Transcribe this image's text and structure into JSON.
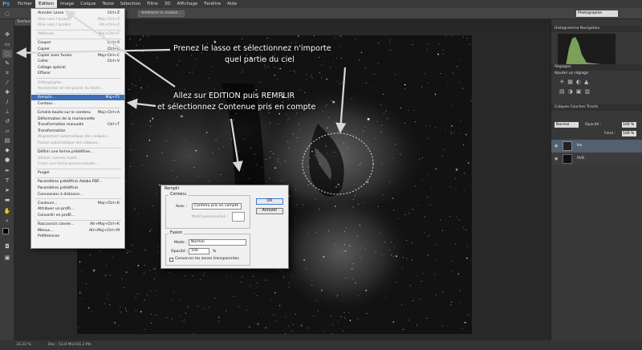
{
  "menubar": {
    "logo": "Ps",
    "items": [
      "Fichier",
      "Edition",
      "Image",
      "Calque",
      "Texte",
      "Sélection",
      "Filtre",
      "3D",
      "Affichage",
      "Fenêtre",
      "Aide"
    ]
  },
  "options": {
    "refine_button": "Améliorer le contour...",
    "workspace": "Photographie"
  },
  "document": {
    "tab": "Test%dat..."
  },
  "edit_menu": {
    "items": [
      {
        "label": "Annuler Lasso",
        "shortcut": "Ctrl+Z"
      },
      {
        "label": "Aller vers l'avant",
        "shortcut": "Maj+Ctrl+Z"
      },
      {
        "label": "Aller vers l'arrière",
        "shortcut": "Alt+Ctrl+Z"
      },
      {
        "label": "Atténuer...",
        "shortcut": "Maj+Ctrl+F"
      },
      {
        "label": "Couper",
        "shortcut": "Ctrl+X"
      },
      {
        "label": "Copier",
        "shortcut": "Ctrl+C"
      },
      {
        "label": "Copier avec fusion",
        "shortcut": "Maj+Ctrl+C"
      },
      {
        "label": "Coller",
        "shortcut": "Ctrl+V"
      },
      {
        "label": "Collage spécial",
        "shortcut": ""
      },
      {
        "label": "Effacer",
        "shortcut": ""
      },
      {
        "label": "Orthographe...",
        "shortcut": ""
      },
      {
        "label": "Rechercher et remplacer du texte...",
        "shortcut": ""
      },
      {
        "label": "Remplir...",
        "shortcut": "Maj+F5"
      },
      {
        "label": "Contour...",
        "shortcut": ""
      },
      {
        "label": "Echelle basée sur le contenu",
        "shortcut": "Maj+Ctrl+A"
      },
      {
        "label": "Déformation de la marionnette",
        "shortcut": ""
      },
      {
        "label": "Transformation manuelle",
        "shortcut": "Ctrl+T"
      },
      {
        "label": "Transformation",
        "shortcut": ""
      },
      {
        "label": "Alignement automatique des calques...",
        "shortcut": ""
      },
      {
        "label": "Fusion automatique des calques...",
        "shortcut": ""
      },
      {
        "label": "Définir une forme prédéfinie...",
        "shortcut": ""
      },
      {
        "label": "Utiliser comme motif...",
        "shortcut": ""
      },
      {
        "label": "Créer une forme personnalisée...",
        "shortcut": ""
      },
      {
        "label": "Purger",
        "shortcut": ""
      },
      {
        "label": "Paramètres prédéfinis Adobe PDF...",
        "shortcut": ""
      },
      {
        "label": "Paramètres prédéfinis",
        "shortcut": ""
      },
      {
        "label": "Connexions à distance...",
        "shortcut": ""
      },
      {
        "label": "Couleurs...",
        "shortcut": "Maj+Ctrl+K"
      },
      {
        "label": "Attribuer un profil...",
        "shortcut": ""
      },
      {
        "label": "Convertir en profil...",
        "shortcut": ""
      },
      {
        "label": "Raccourcis clavier...",
        "shortcut": "Alt+Maj+Ctrl+K"
      },
      {
        "label": "Menus...",
        "shortcut": "Alt+Maj+Ctrl+M"
      },
      {
        "label": "Préférences",
        "shortcut": ""
      }
    ]
  },
  "annotations": {
    "lasso_line1": "Prenez le lasso et sélectionnez n'importe",
    "lasso_line2": "quel partie du ciel",
    "fill_line1": "Allez sur EDITION puis REMPLIR",
    "fill_line2": "et sélectionnez Contenue pris en compte"
  },
  "dialog": {
    "title": "Remplir",
    "contenu_group": "Contenu",
    "avec_label": "Avec :",
    "avec_value": "Contenu pris en compte",
    "motif_label": "Motif personnalisé :",
    "ok": "OK",
    "cancel": "Annuler",
    "fusion_group": "Fusion",
    "mode_label": "Mode :",
    "mode_value": "Normal",
    "opacity_label": "Opacité :",
    "opacity_value": "100",
    "opacity_unit": "%",
    "preserve_label": "Conserver les zones transparentes"
  },
  "panels": {
    "histogram_tabs": "Histogramme   Navigation",
    "adjust_tab": "Réglages",
    "adjust_add": "Ajouter un réglage",
    "layers_tabs": "Calques   Couches   Tracés",
    "blend_mode": "Normal",
    "opacity_label": "Opacité :",
    "opacity_value": "100 %",
    "fill_label": "Fond :",
    "fill_value": "100 %",
    "layers": [
      "Ha",
      "RVB"
    ]
  },
  "status": {
    "zoom": "33,33 %",
    "doc": "Doc : 53,8 Mo/141,2 Mo"
  }
}
